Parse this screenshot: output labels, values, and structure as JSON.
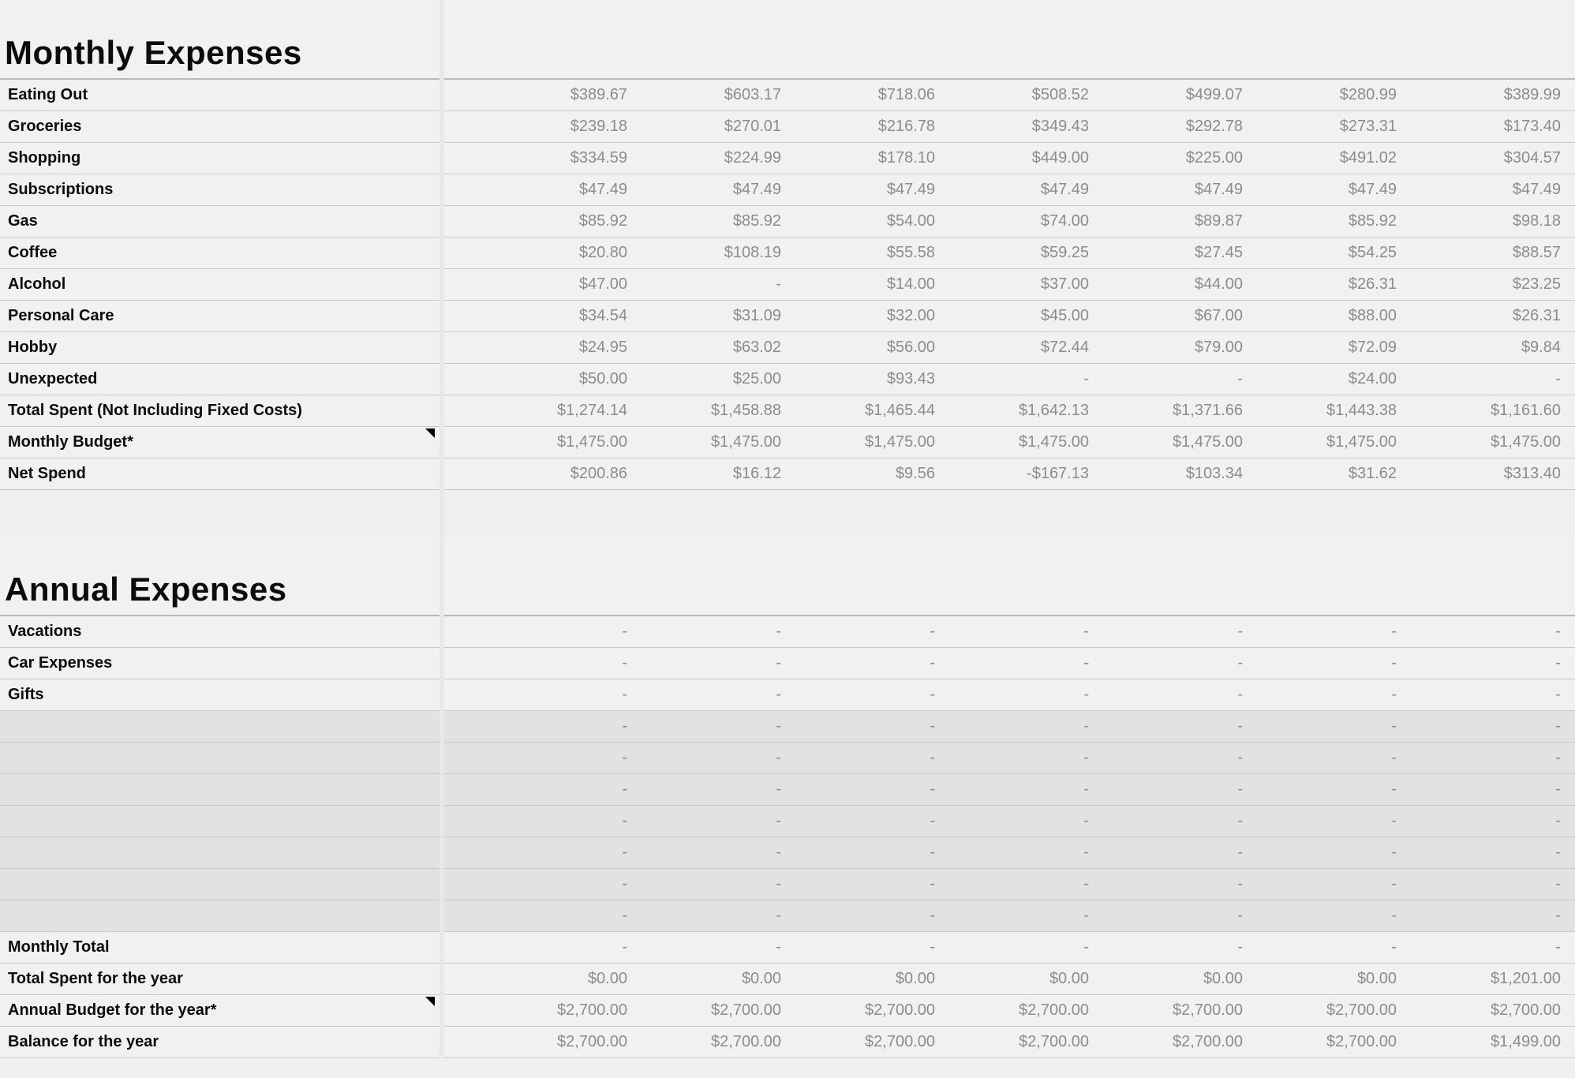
{
  "sections": {
    "monthly": {
      "title": "Monthly Expenses",
      "rows": [
        {
          "label": "Eating Out",
          "v": [
            "$389.67",
            "$603.17",
            "$718.06",
            "$508.52",
            "$499.07",
            "$280.99",
            "$389.99"
          ]
        },
        {
          "label": "Groceries",
          "v": [
            "$239.18",
            "$270.01",
            "$216.78",
            "$349.43",
            "$292.78",
            "$273.31",
            "$173.40"
          ]
        },
        {
          "label": "Shopping",
          "v": [
            "$334.59",
            "$224.99",
            "$178.10",
            "$449.00",
            "$225.00",
            "$491.02",
            "$304.57"
          ]
        },
        {
          "label": "Subscriptions",
          "v": [
            "$47.49",
            "$47.49",
            "$47.49",
            "$47.49",
            "$47.49",
            "$47.49",
            "$47.49"
          ]
        },
        {
          "label": "Gas",
          "v": [
            "$85.92",
            "$85.92",
            "$54.00",
            "$74.00",
            "$89.87",
            "$85.92",
            "$98.18"
          ]
        },
        {
          "label": "Coffee",
          "v": [
            "$20.80",
            "$108.19",
            "$55.58",
            "$59.25",
            "$27.45",
            "$54.25",
            "$88.57"
          ]
        },
        {
          "label": "Alcohol",
          "v": [
            "$47.00",
            "-",
            "$14.00",
            "$37.00",
            "$44.00",
            "$26.31",
            "$23.25"
          ]
        },
        {
          "label": "Personal Care",
          "v": [
            "$34.54",
            "$31.09",
            "$32.00",
            "$45.00",
            "$67.00",
            "$88.00",
            "$26.31"
          ]
        },
        {
          "label": "Hobby",
          "v": [
            "$24.95",
            "$63.02",
            "$56.00",
            "$72.44",
            "$79.00",
            "$72.09",
            "$9.84"
          ]
        },
        {
          "label": "Unexpected",
          "v": [
            "$50.00",
            "$25.00",
            "$93.43",
            "-",
            "-",
            "$24.00",
            "-"
          ]
        },
        {
          "label": "Total Spent (Not Including Fixed Costs)",
          "v": [
            "$1,274.14",
            "$1,458.88",
            "$1,465.44",
            "$1,642.13",
            "$1,371.66",
            "$1,443.38",
            "$1,161.60"
          ]
        },
        {
          "label": "Monthly Budget*",
          "note": true,
          "v": [
            "$1,475.00",
            "$1,475.00",
            "$1,475.00",
            "$1,475.00",
            "$1,475.00",
            "$1,475.00",
            "$1,475.00"
          ]
        },
        {
          "label": "Net Spend",
          "v": [
            "$200.86",
            "$16.12",
            "$9.56",
            "-$167.13",
            "$103.34",
            "$31.62",
            "$313.40"
          ]
        }
      ]
    },
    "annual": {
      "title": "Annual Expenses",
      "rows": [
        {
          "label": "Vacations",
          "v": [
            "-",
            "-",
            "-",
            "-",
            "-",
            "-",
            "-"
          ]
        },
        {
          "label": "Car Expenses",
          "v": [
            "-",
            "-",
            "-",
            "-",
            "-",
            "-",
            "-"
          ]
        },
        {
          "label": "Gifts",
          "v": [
            "-",
            "-",
            "-",
            "-",
            "-",
            "-",
            "-"
          ]
        },
        {
          "label": "",
          "grey": true,
          "v": [
            "-",
            "-",
            "-",
            "-",
            "-",
            "-",
            "-"
          ]
        },
        {
          "label": "",
          "grey": true,
          "v": [
            "-",
            "-",
            "-",
            "-",
            "-",
            "-",
            "-"
          ]
        },
        {
          "label": "",
          "grey": true,
          "v": [
            "-",
            "-",
            "-",
            "-",
            "-",
            "-",
            "-"
          ]
        },
        {
          "label": "",
          "grey": true,
          "v": [
            "-",
            "-",
            "-",
            "-",
            "-",
            "-",
            "-"
          ]
        },
        {
          "label": "",
          "grey": true,
          "v": [
            "-",
            "-",
            "-",
            "-",
            "-",
            "-",
            "-"
          ]
        },
        {
          "label": "",
          "grey": true,
          "v": [
            "-",
            "-",
            "-",
            "-",
            "-",
            "-",
            "-"
          ]
        },
        {
          "label": "",
          "grey": true,
          "v": [
            "-",
            "-",
            "-",
            "-",
            "-",
            "-",
            "-"
          ]
        },
        {
          "label": "Monthly Total",
          "v": [
            "-",
            "-",
            "-",
            "-",
            "-",
            "-",
            "-"
          ]
        },
        {
          "label": "Total Spent for the year",
          "v": [
            "$0.00",
            "$0.00",
            "$0.00",
            "$0.00",
            "$0.00",
            "$0.00",
            "$1,201.00"
          ]
        },
        {
          "label": "Annual Budget for the year*",
          "note": true,
          "v": [
            "$2,700.00",
            "$2,700.00",
            "$2,700.00",
            "$2,700.00",
            "$2,700.00",
            "$2,700.00",
            "$2,700.00"
          ]
        },
        {
          "label": "Balance for the year",
          "v": [
            "$2,700.00",
            "$2,700.00",
            "$2,700.00",
            "$2,700.00",
            "$2,700.00",
            "$2,700.00",
            "$1,499.00"
          ]
        }
      ]
    }
  }
}
